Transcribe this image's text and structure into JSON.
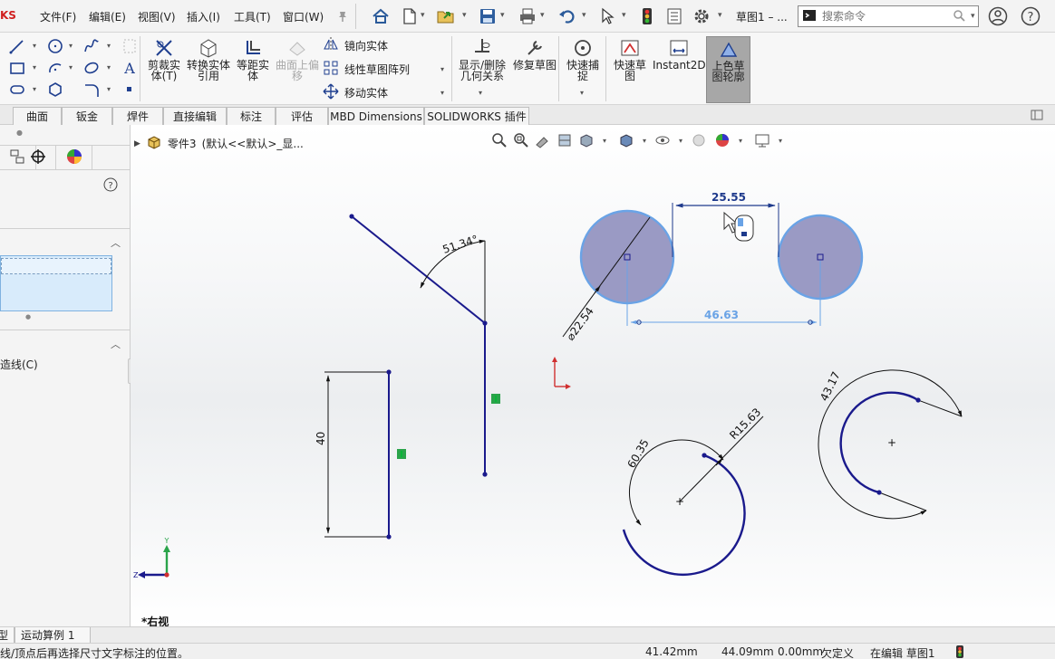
{
  "app": {
    "brand": "KS"
  },
  "menu": [
    "文件(F)",
    "编辑(E)",
    "视图(V)",
    "插入(I)",
    "工具(T)",
    "窗口(W)"
  ],
  "document": {
    "title": "草图1 – ..."
  },
  "search": {
    "placeholder": "搜索命令"
  },
  "ribbon": {
    "buttons": [
      "剪裁实体(T)",
      "转换实体引用",
      "等距实体",
      "曲面上偏移",
      "显示/删除几何关系",
      "修复草图",
      "快速捕捉",
      "快速草图",
      "Instant2D",
      "上色草图轮廓"
    ],
    "rows": [
      "镜向实体",
      "线性草图阵列",
      "移动实体"
    ]
  },
  "tabs": [
    "曲面",
    "钣金",
    "焊件",
    "直接编辑",
    "标注",
    "评估",
    "MBD Dimensions",
    "SOLIDWORKS 插件"
  ],
  "left_panel": {
    "label": "造线(C)"
  },
  "tree": {
    "part": "零件3",
    "config": "(默认<<默认>_显..."
  },
  "viewport": {
    "view_label": "*右视",
    "dimensions": {
      "angle": "51.34°",
      "length": "40",
      "diameter": "⌀22.54",
      "center_distance": "25.55",
      "span": "46.63",
      "arc_angle": "60.35",
      "radius": "R15.63",
      "arc_length": "43.17"
    },
    "axis_labels": {
      "y": "Y",
      "z": "Z"
    }
  },
  "bottom_tabs": [
    "模型",
    "运动算例 1"
  ],
  "status": {
    "message": "线/顶点后再选择尺寸文字标注的位置。",
    "x": "41.42mm",
    "y": "44.09mm",
    "z": "0.00mm",
    "defined": "欠定义",
    "mode": "在编辑 草图1"
  }
}
